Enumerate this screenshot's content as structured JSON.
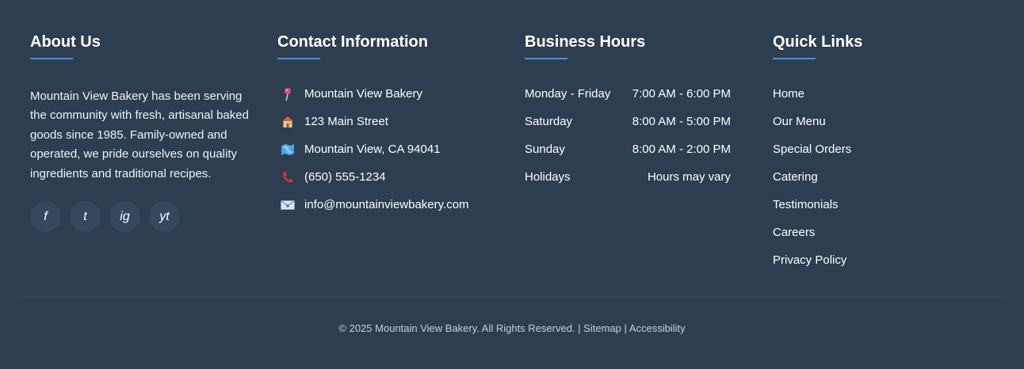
{
  "about": {
    "heading": "About Us",
    "text": "Mountain View Bakery has been serving the community with fresh, artisanal baked goods since 1985. Family-owned and operated, we pride ourselves on quality ingredients and traditional recipes.",
    "socials": [
      {
        "label": "f",
        "icon": "facebook-icon"
      },
      {
        "label": "t",
        "icon": "twitter-icon"
      },
      {
        "label": "ig",
        "icon": "instagram-icon"
      },
      {
        "label": "yt",
        "icon": "youtube-icon"
      }
    ]
  },
  "contact": {
    "heading": "Contact Information",
    "items": [
      {
        "icon": "pin-icon",
        "text": "Mountain View Bakery"
      },
      {
        "icon": "house-icon",
        "text": "123 Main Street"
      },
      {
        "icon": "map-icon",
        "text": "Mountain View, CA 94041"
      },
      {
        "icon": "phone-icon",
        "text": "(650) 555-1234"
      },
      {
        "icon": "email-icon",
        "text": "info@mountainviewbakery.com"
      }
    ]
  },
  "hours": {
    "heading": "Business Hours",
    "rows": [
      {
        "day": "Monday - Friday",
        "time": "7:00 AM - 6:00 PM"
      },
      {
        "day": "Saturday",
        "time": "8:00 AM - 5:00 PM"
      },
      {
        "day": "Sunday",
        "time": "8:00 AM - 2:00 PM"
      },
      {
        "day": "Holidays",
        "time": "Hours may vary"
      }
    ]
  },
  "links": {
    "heading": "Quick Links",
    "items": [
      "Home",
      "Our Menu",
      "Special Orders",
      "Catering",
      "Testimonials",
      "Careers",
      "Privacy Policy"
    ]
  },
  "footer": {
    "copyright": "© 2025 Mountain View Bakery. All Rights Reserved. |",
    "sitemap": "Sitemap",
    "separator": "|",
    "accessibility": "Accessibility"
  },
  "colors": {
    "background": "#2c3e50",
    "accent": "#4a90d9",
    "social_bg": "#34495e"
  }
}
